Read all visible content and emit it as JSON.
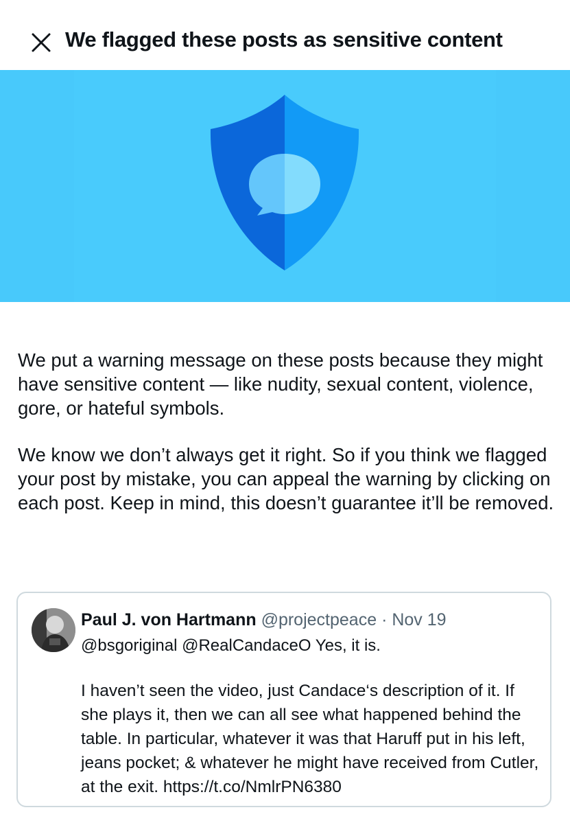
{
  "header": {
    "title": "We flagged these posts as sensitive content",
    "close_icon": "close-icon"
  },
  "banner": {
    "icon": "shield-chat-icon",
    "colors": {
      "background": "#48c9fb",
      "shield_left": "#0b67da",
      "shield_right": "#129af6",
      "bubble": "#64c6fb"
    }
  },
  "message": {
    "paragraph_1": "We put a warning message on these posts because they might have sensitive content — like nudity, sexual content, violence, gore, or hateful symbols.",
    "paragraph_2": "We know we don’t always get it right. So if you think we flagged your post by mistake, you can appeal the warning by clicking on each post. Keep in mind, this doesn’t guarantee it’ll be removed."
  },
  "post": {
    "author": "Paul J. von Hartmann",
    "handle": "@projectpeace",
    "separator": "·",
    "date": "Nov 19",
    "reply_text": "@bsgoriginal @RealCandaceO Yes, it is.",
    "body": "I haven’t seen the video, just Candace‘s description of it. If she plays it, then we can all see what happened behind the table. In particular, whatever it was that Haruff put in his left, jeans pocket; & whatever he might have received from Cutler, at the exit. https://t.co/NmlrPN6380"
  }
}
